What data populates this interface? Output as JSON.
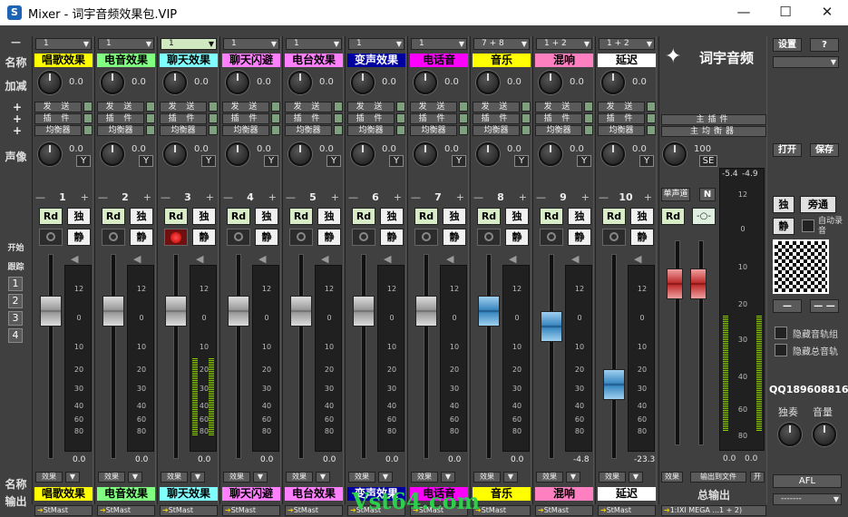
{
  "window": {
    "title": "Mixer - 词宇音频效果包.VIP",
    "minimize": "—",
    "maximize": "☐",
    "close": "✕",
    "app_icon": "S"
  },
  "labels": {
    "name": "名称",
    "gain": "加减",
    "pan": "声像",
    "output": "输出",
    "start": "开始",
    "follow": "跟踪",
    "collapse": "—",
    "plus": "+"
  },
  "pages": [
    "1",
    "2",
    "3",
    "4"
  ],
  "channels": [
    {
      "num": "1",
      "input": "1",
      "name": "唱歌效果",
      "color": "#ffff00",
      "gain": "0.0",
      "pan": "0.0",
      "send": "发 送",
      "insert": "插 件",
      "eq": "均衡器",
      "meter": "0.0",
      "fader_db": 0,
      "output": "StMast",
      "fx": "效果",
      "rec": false
    },
    {
      "num": "2",
      "input": "1",
      "name": "电音效果",
      "color": "#80ff80",
      "gain": "0.0",
      "pan": "0.0",
      "send": "发 送",
      "insert": "插 件",
      "eq": "均衡器",
      "meter": "0.0",
      "fader_db": 0,
      "output": "StMast",
      "fx": "效果",
      "rec": false
    },
    {
      "num": "3",
      "input": "1",
      "name": "聊天效果",
      "color": "#80ffff",
      "gain": "0.0",
      "pan": "0.0",
      "send": "发 送",
      "insert": "插 件",
      "eq": "均衡器",
      "meter": "0.0",
      "fader_db": 0,
      "output": "StMast",
      "fx": "效果",
      "rec": true
    },
    {
      "num": "4",
      "input": "1",
      "name": "聊天闪避",
      "color": "#ff80ff",
      "gain": "0.0",
      "pan": "0.0",
      "send": "发 送",
      "insert": "插 件",
      "eq": "均衡器",
      "meter": "0.0",
      "fader_db": 0,
      "output": "StMast",
      "fx": "效果",
      "rec": false
    },
    {
      "num": "5",
      "input": "1",
      "name": "电台效果",
      "color": "#ff80ff",
      "gain": "0.0",
      "pan": "0.0",
      "send": "发 送",
      "insert": "插 件",
      "eq": "均衡器",
      "meter": "0.0",
      "fader_db": 0,
      "output": "StMast",
      "fx": "效果",
      "rec": false
    },
    {
      "num": "6",
      "input": "1",
      "name": "变声效果",
      "color": "#0000a0",
      "gain": "0.0",
      "pan": "0.0",
      "send": "发 送",
      "insert": "插 件",
      "eq": "均衡器",
      "meter": "0.0",
      "fader_db": 0,
      "output": "StMast",
      "fx": "效果",
      "rec": false
    },
    {
      "num": "7",
      "input": "1",
      "name": "电话音",
      "color": "#ff00ff",
      "gain": "0.0",
      "pan": "0.0",
      "send": "发 送",
      "insert": "插 件",
      "eq": "均衡器",
      "meter": "0.0",
      "fader_db": 0,
      "output": "StMast",
      "fx": "效果",
      "rec": false
    },
    {
      "num": "8",
      "input": "7 + 8",
      "name": "音乐",
      "color": "#ffff00",
      "gain": "0.0",
      "pan": "0.0",
      "send": "发 送",
      "insert": "插 件",
      "eq": "均衡器",
      "meter": "0.0",
      "fader_db": 0,
      "output": "StMast",
      "fx": "效果",
      "rec": false
    },
    {
      "num": "9",
      "input": "1 + 2",
      "name": "混响",
      "color": "#ff80c0",
      "gain": "0.0",
      "pan": "0.0",
      "send": "发 送",
      "insert": "插 件",
      "eq": "均衡器",
      "meter": "-4.8",
      "fader_db": -4.8,
      "output": "StMast",
      "fx": "效果",
      "rec": false
    },
    {
      "num": "10",
      "input": "1 + 2",
      "name": "延迟",
      "color": "#ffffff",
      "gain": "0.0",
      "pan": "0.0",
      "send": "发 送",
      "insert": "插 件",
      "eq": "均衡器",
      "meter": "-23.3",
      "fader_db": -23.3,
      "output": "StMast",
      "fx": "效果",
      "rec": false
    }
  ],
  "master": {
    "logo": "词宇音频",
    "insert": "主插件",
    "eq": "主均衡器",
    "pan": "100",
    "se": "SE",
    "mono": "单声道",
    "n": "N",
    "rd": "Rd",
    "peak_l": "-5.4",
    "peak_r": "-4.9",
    "val_l": "0.0",
    "val_r": "0.0",
    "fx": "效果",
    "export": "输出到文件",
    "on": "开",
    "name": "总输出",
    "output": "1:IXI MEGA ...1 + 2)"
  },
  "right": {
    "settings": "设置",
    "help": "?",
    "open": "打开",
    "save": "保存",
    "solo": "独",
    "bypass": "旁通",
    "mute": "静",
    "auto_record": "自动录音",
    "minus": "—",
    "dash": "— —",
    "hide_tracks": "隐藏音轨组",
    "hide_master": "隐藏总音轨",
    "qq": "QQ189608816",
    "solo_knob": "独奏",
    "volume": "音量",
    "afl": "AFL",
    "out_sel": "-------"
  },
  "scale": [
    "12",
    "0",
    "10",
    "20",
    "30",
    "40",
    "60",
    "80"
  ],
  "watermark": "Vst64.com"
}
